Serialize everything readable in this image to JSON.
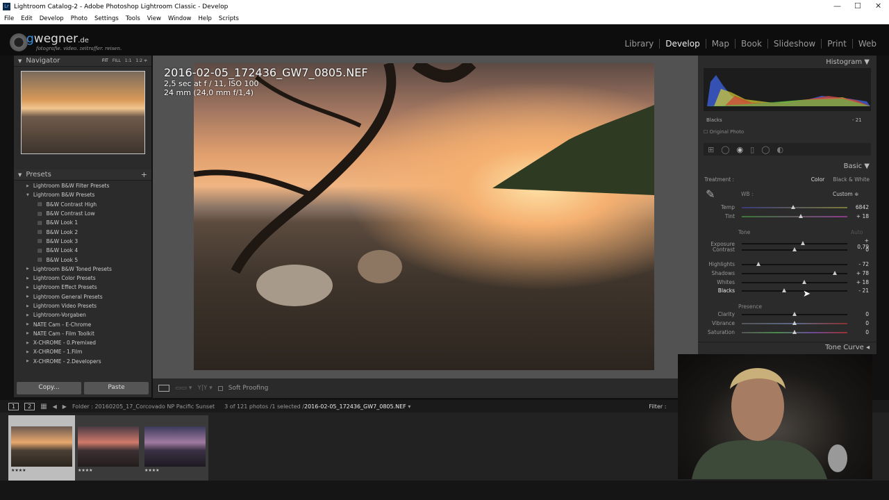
{
  "window": {
    "title": "Lightroom Catalog-2 - Adobe Photoshop Lightroom Classic - Develop",
    "icon": "Lr"
  },
  "menu": [
    "File",
    "Edit",
    "Develop",
    "Photo",
    "Settings",
    "Tools",
    "View",
    "Window",
    "Help",
    "Scripts"
  ],
  "logo": {
    "brand_g": "g",
    "brand_rest": "wegner",
    "brand_tld": ".de",
    "tagline": "fotografie. video. zeitraffer. reisen."
  },
  "modules": [
    "Library",
    "Develop",
    "Map",
    "Book",
    "Slideshow",
    "Print",
    "Web"
  ],
  "active_module": "Develop",
  "navigator": {
    "title": "Navigator",
    "zoom": [
      "FIT",
      "FILL",
      "1:1",
      "1:2 ≑"
    ]
  },
  "presets": {
    "title": "Presets",
    "add": "+",
    "items": [
      {
        "label": "Lightroom B&W Filter Presets",
        "type": "folder"
      },
      {
        "label": "Lightroom B&W Presets",
        "type": "open"
      },
      {
        "label": "B&W Contrast High",
        "type": "item"
      },
      {
        "label": "B&W Contrast Low",
        "type": "item"
      },
      {
        "label": "B&W Look 1",
        "type": "item"
      },
      {
        "label": "B&W Look 2",
        "type": "item"
      },
      {
        "label": "B&W Look 3",
        "type": "item"
      },
      {
        "label": "B&W Look 4",
        "type": "item"
      },
      {
        "label": "B&W Look 5",
        "type": "item"
      },
      {
        "label": "Lightroom B&W Toned Presets",
        "type": "folder"
      },
      {
        "label": "Lightroom Color Presets",
        "type": "folder"
      },
      {
        "label": "Lightroom Effect Presets",
        "type": "folder"
      },
      {
        "label": "Lightroom General Presets",
        "type": "folder"
      },
      {
        "label": "Lightroom Video Presets",
        "type": "folder"
      },
      {
        "label": "Lightroom-Vorgaben",
        "type": "folder"
      },
      {
        "label": "NATE Cam - E-Chrome",
        "type": "folder"
      },
      {
        "label": "NATE Cam - Film Toolkit",
        "type": "folder"
      },
      {
        "label": "X-CHROME - 0.Premixed",
        "type": "folder"
      },
      {
        "label": "X-CHROME - 1.Film",
        "type": "folder"
      },
      {
        "label": "X-CHROME - 2.Developers",
        "type": "folder"
      }
    ]
  },
  "buttons": {
    "copy": "Copy...",
    "paste": "Paste"
  },
  "photo_info": {
    "filename": "2016-02-05_172436_GW7_0805.NEF",
    "exposure": "2,5 sec at f / 11, ISO 100",
    "lens": "24 mm (24,0 mm f/1,4)"
  },
  "toolbar": {
    "soft_proofing": "Soft Proofing"
  },
  "histogram": {
    "title": "Histogram",
    "readout_label": "Blacks",
    "readout_value": "- 21",
    "original_photo": "Original Photo"
  },
  "basic": {
    "title": "Basic",
    "treatment_label": "Treatment :",
    "treatment_color": "Color",
    "treatment_bw": "Black & White",
    "wb_label": "WB :",
    "wb_value": "Custom ≑",
    "tone_label": "Tone",
    "auto": "Auto",
    "presence_label": "Presence",
    "sliders": [
      {
        "label": "Temp",
        "value": "6842",
        "pos": 0.49
      },
      {
        "label": "Tint",
        "value": "+ 18",
        "pos": 0.56
      },
      {
        "label": "Exposure",
        "value": "+ 0,79",
        "pos": 0.58
      },
      {
        "label": "Contrast",
        "value": "0",
        "pos": 0.5
      },
      {
        "label": "Highlights",
        "value": "- 72",
        "pos": 0.16
      },
      {
        "label": "Shadows",
        "value": "+ 78",
        "pos": 0.88
      },
      {
        "label": "Whites",
        "value": "+ 18",
        "pos": 0.59
      },
      {
        "label": "Blacks",
        "value": "- 21",
        "pos": 0.4
      },
      {
        "label": "Clarity",
        "value": "0",
        "pos": 0.5
      },
      {
        "label": "Vibrance",
        "value": "0",
        "pos": 0.5
      },
      {
        "label": "Saturation",
        "value": "0",
        "pos": 0.5
      }
    ]
  },
  "tone_curve": {
    "title": "Tone Curve"
  },
  "filmstrip": {
    "view1": "1",
    "view2": "2",
    "folder": "Folder : 20160205_17_Corcovado NP Pacific Sunset",
    "count": "3 of 121 photos /1 selected /",
    "selected_file": "2016-02-05_172436_GW7_0805.NEF",
    "filter": "Filter :",
    "stars": "★★★★"
  }
}
